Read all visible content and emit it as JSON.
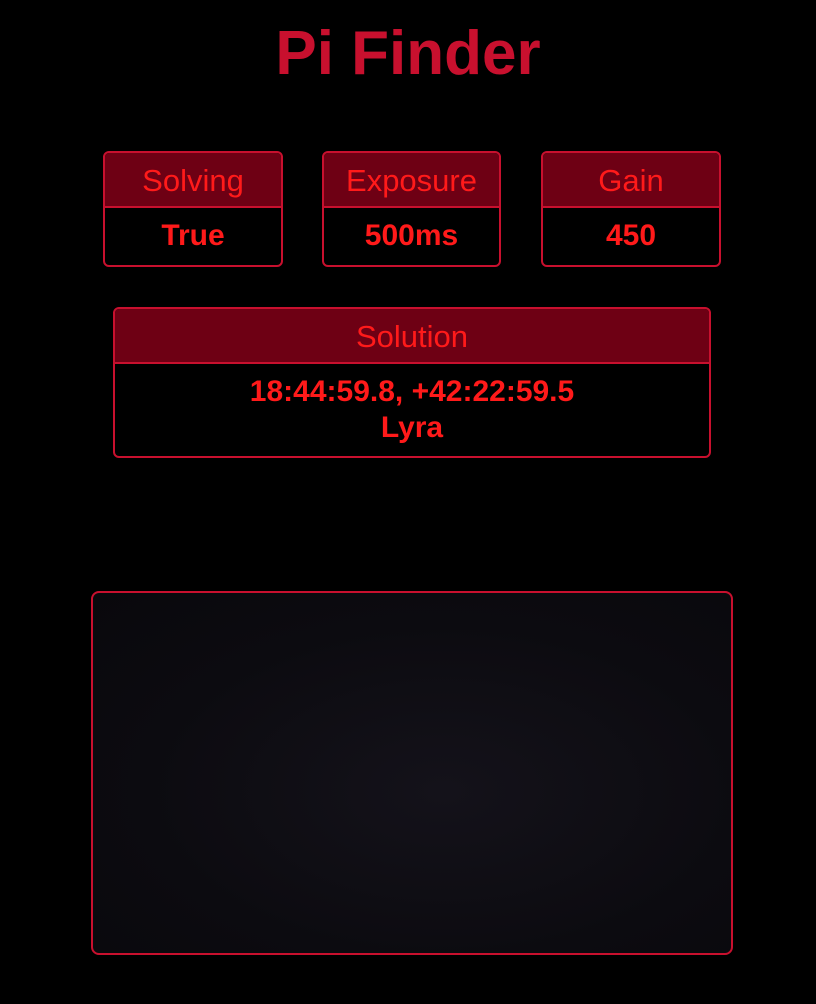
{
  "header": {
    "title": "Pi Finder"
  },
  "status": {
    "solving": {
      "label": "Solving",
      "value": "True"
    },
    "exposure": {
      "label": "Exposure",
      "value": "500ms"
    },
    "gain": {
      "label": "Gain",
      "value": "450"
    }
  },
  "solution": {
    "label": "Solution",
    "coordinates": "18:44:59.8, +42:22:59.5",
    "constellation": "Lyra"
  },
  "colors": {
    "background": "#000000",
    "accent": "#c8102e",
    "header_fill": "#6e0014",
    "text": "#ff1a1a"
  }
}
